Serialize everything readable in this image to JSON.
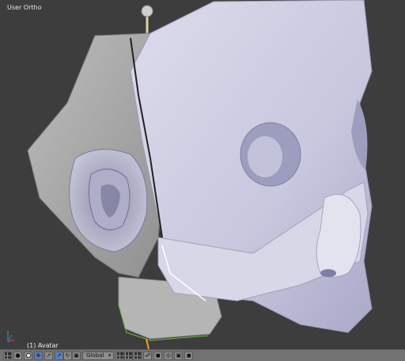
{
  "viewport": {
    "view_label": "User Ortho",
    "object_label": "(1) Avatar"
  },
  "header": {
    "transform_orientation": "Global",
    "colors": {
      "bar_background": "#727272",
      "active_button": "#5680c2",
      "viewport_background": "#3d3d3d"
    },
    "icons": [
      "view-type-icon",
      "shading-solid-icon",
      "pivot-icon",
      "manipulator-icon",
      "translate-icon",
      "rotate-icon",
      "scale-icon",
      "layers-icon",
      "lock-icon",
      "render-icon",
      "camera-icon"
    ]
  }
}
